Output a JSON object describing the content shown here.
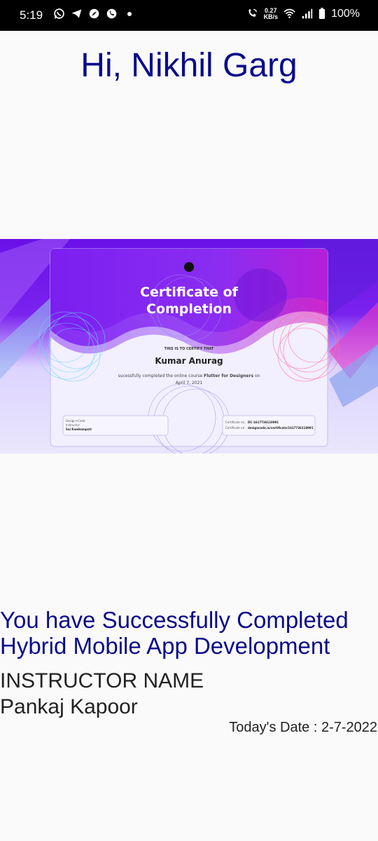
{
  "status_bar": {
    "time": "5:19",
    "speed_value": "0.27",
    "speed_unit": "KB/s",
    "battery": "100%",
    "icons": [
      "whatsapp-icon",
      "telegram-icon",
      "compass-icon",
      "phone-icon",
      "dot-icon",
      "call-wifi-icon",
      "wifi-icon",
      "signal-icon",
      "battery-icon"
    ]
  },
  "greeting": "Hi, Nikhil Garg",
  "certificate": {
    "title_line1": "Certificate of",
    "title_line2": "Completion",
    "certify_text": "THIS IS TO CERTIFY THAT",
    "recipient": "Kumar Anurag",
    "course_line_prefix": "sucessfully completed the online course ",
    "course_name": "Flutter for Designers",
    "course_line_suffix": " on",
    "date": "April 7, 2021",
    "org": "Design+Code",
    "instructor_label": "Instructor:",
    "instructor_name": "Sai Kambampati",
    "cert_no_label": "Certificate no:",
    "cert_no": "DC-1617736118991",
    "cert_url_label": "Certificate url:",
    "cert_url": "designcode.io/certificate/1617736118991"
  },
  "completed_line1": "You have Successfully Completed",
  "completed_line2": "Hybrid Mobile App Development",
  "instructor_heading": "INSTRUCTOR NAME",
  "instructor_name": "Pankaj Kapoor",
  "todays_date": "Today's Date : 2-7-2022",
  "colors": {
    "heading_blue": "#0b0b8a",
    "cert_purple": "#6a11e8",
    "cert_magenta": "#c21bd4"
  }
}
